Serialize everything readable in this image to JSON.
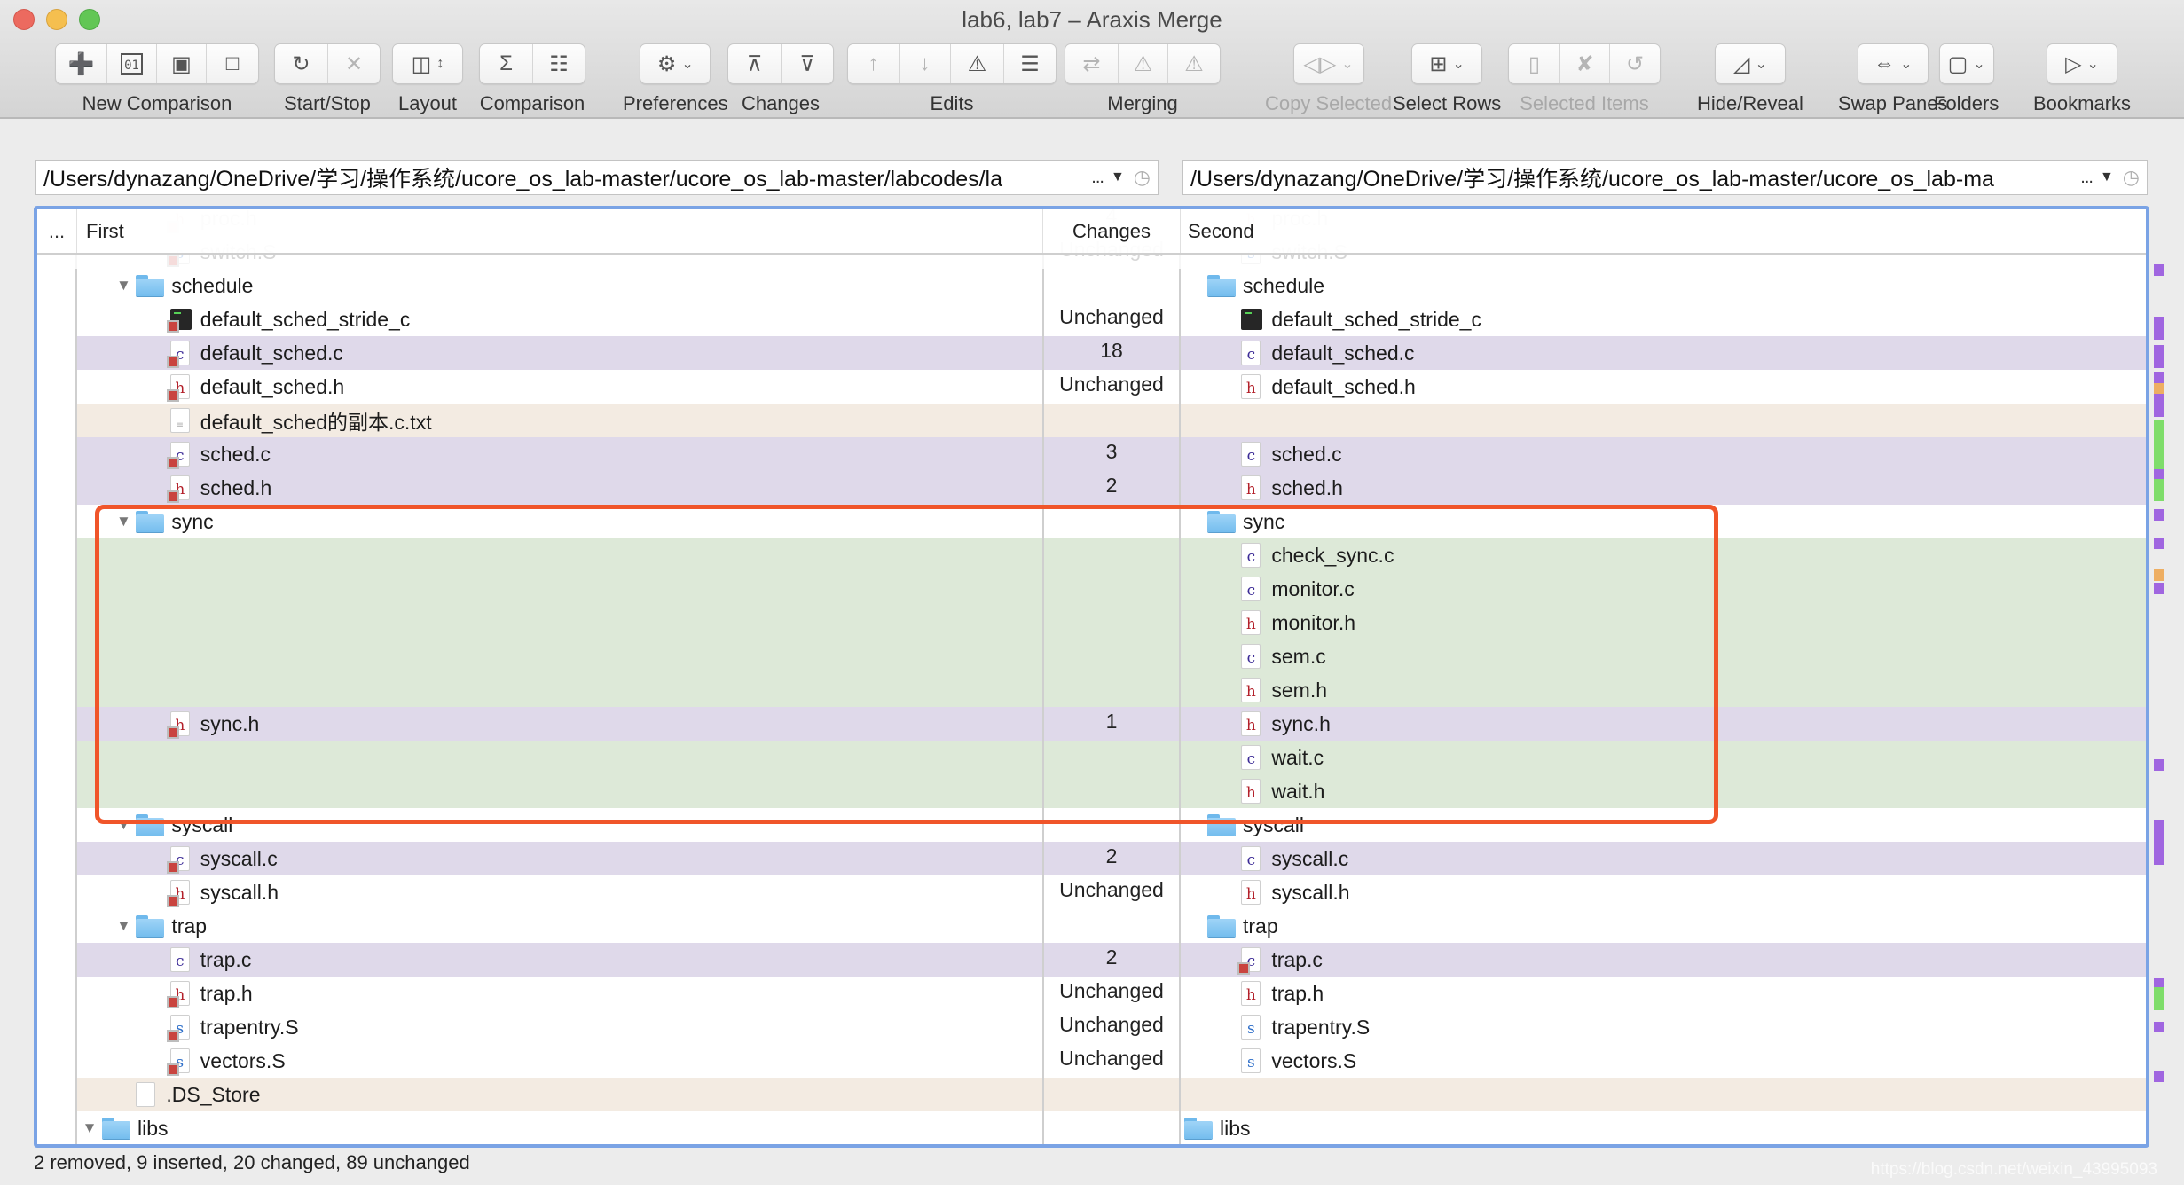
{
  "window": {
    "title": "lab6, lab7 – Araxis Merge"
  },
  "toolbar": {
    "groups": [
      {
        "label": "New Comparison",
        "enabled": true,
        "buttons": [
          {
            "icon": "new-text-comparison-icon",
            "glyph": "➕",
            "enabled": true
          },
          {
            "icon": "new-binary-comparison-icon",
            "glyph": "01",
            "enabled": true
          },
          {
            "icon": "new-image-comparison-icon",
            "glyph": "▣",
            "enabled": true
          },
          {
            "icon": "new-folder-comparison-icon",
            "glyph": "□",
            "enabled": true
          }
        ]
      },
      {
        "label": "Start/Stop",
        "enabled": true,
        "buttons": [
          {
            "icon": "refresh-icon",
            "glyph": "↻",
            "enabled": true
          },
          {
            "icon": "stop-icon",
            "glyph": "✕",
            "enabled": false
          }
        ]
      },
      {
        "label": "Layout",
        "enabled": true,
        "buttons": [
          {
            "icon": "two-pane-layout-icon",
            "glyph": "◫",
            "enabled": true,
            "dropdown": "↕"
          }
        ]
      },
      {
        "label": "Comparison",
        "enabled": true,
        "buttons": [
          {
            "icon": "sigma-report-icon",
            "glyph": "Σ",
            "enabled": true
          },
          {
            "icon": "document-report-icon",
            "glyph": "☷",
            "enabled": true
          }
        ]
      },
      {
        "label": "Preferences",
        "enabled": true,
        "buttons": [
          {
            "icon": "gear-icon",
            "glyph": "⚙",
            "enabled": true,
            "dropdown": "⌄"
          }
        ]
      },
      {
        "label": "Changes",
        "enabled": true,
        "buttons": [
          {
            "icon": "previous-change-icon",
            "glyph": "⊼",
            "enabled": true
          },
          {
            "icon": "next-change-icon",
            "glyph": "⊽",
            "enabled": true
          }
        ]
      },
      {
        "label": "Edits",
        "enabled": true,
        "buttons": [
          {
            "icon": "previous-edit-icon",
            "glyph": "↑",
            "enabled": false
          },
          {
            "icon": "next-edit-icon",
            "glyph": "↓",
            "enabled": false
          },
          {
            "icon": "conflict-edit-icon",
            "glyph": "⚠",
            "enabled": true
          },
          {
            "icon": "edit-list-icon",
            "glyph": "☰",
            "enabled": true
          }
        ]
      },
      {
        "label": "Merging",
        "enabled": true,
        "buttons": [
          {
            "icon": "merge-icon",
            "glyph": "⇄",
            "enabled": false
          },
          {
            "icon": "previous-conflict-icon",
            "glyph": "⚠",
            "enabled": false
          },
          {
            "icon": "next-conflict-icon",
            "glyph": "⚠",
            "enabled": false
          }
        ]
      },
      {
        "label": "Copy Selected",
        "enabled": false,
        "buttons": [
          {
            "icon": "copy-selected-icon",
            "glyph": "◁▷",
            "enabled": false,
            "dropdown": "⌄"
          }
        ]
      },
      {
        "label": "Select Rows",
        "enabled": true,
        "buttons": [
          {
            "icon": "select-rows-icon",
            "glyph": "⊞",
            "enabled": true,
            "dropdown": "⌄"
          }
        ]
      },
      {
        "label": "Selected Items",
        "enabled": false,
        "buttons": [
          {
            "icon": "open-items-icon",
            "glyph": "▯",
            "enabled": false
          },
          {
            "icon": "delete-items-icon",
            "glyph": "✘",
            "enabled": false
          },
          {
            "icon": "touch-items-icon",
            "glyph": "↺",
            "enabled": false
          }
        ]
      },
      {
        "label": "Hide/Reveal",
        "enabled": true,
        "buttons": [
          {
            "icon": "hide-reveal-icon",
            "glyph": "◿",
            "enabled": true,
            "dropdown": "⌄"
          }
        ]
      },
      {
        "label": "Swap Panes",
        "enabled": true,
        "buttons": [
          {
            "icon": "swap-panes-icon",
            "glyph": "⇔",
            "enabled": true,
            "dropdown": "⌄"
          }
        ]
      },
      {
        "label": "Folders",
        "enabled": true,
        "buttons": [
          {
            "icon": "folders-icon",
            "glyph": "▢",
            "enabled": true,
            "dropdown": "⌄"
          }
        ]
      },
      {
        "label": "Bookmarks",
        "enabled": true,
        "buttons": [
          {
            "icon": "bookmark-icon",
            "glyph": "▷",
            "enabled": true,
            "dropdown": "⌄"
          }
        ]
      }
    ]
  },
  "paths": {
    "first": "/Users/dynazang/OneDrive/学习/操作系统/ucore_os_lab-master/ucore_os_lab-master/labcodes/la",
    "second": "/Users/dynazang/OneDrive/学习/操作系统/ucore_os_lab-master/ucore_os_lab-ma",
    "ellipsis": "...",
    "dropdown_glyph": "▼",
    "history_glyph": "◷"
  },
  "table": {
    "headers": {
      "gutter": "...",
      "first": "First",
      "changes": "Changes",
      "second": "Second"
    },
    "rows": [
      {
        "status": "faded",
        "first": {
          "name": "proc.h",
          "type": "h",
          "indent": 2,
          "removed_badge": true
        },
        "changes": "4",
        "second": {
          "name": "proc.h",
          "type": "h",
          "indent": 1
        }
      },
      {
        "status": "faded",
        "first": {
          "name": "switch.S",
          "type": "s",
          "indent": 2,
          "removed_badge": true
        },
        "changes": "Unchanged",
        "second": {
          "name": "switch.S",
          "type": "s",
          "indent": 1
        }
      },
      {
        "status": "normal",
        "first": {
          "name": "schedule",
          "type": "folder",
          "indent": 1,
          "expanded": true
        },
        "changes": "",
        "second": {
          "name": "schedule",
          "type": "folder",
          "indent": 0
        }
      },
      {
        "status": "normal",
        "first": {
          "name": "default_sched_stride_c",
          "type": "exec",
          "indent": 2,
          "removed_badge": true
        },
        "changes": "Unchanged",
        "second": {
          "name": "default_sched_stride_c",
          "type": "exec",
          "indent": 1
        }
      },
      {
        "status": "changed",
        "first": {
          "name": "default_sched.c",
          "type": "c",
          "indent": 2,
          "removed_badge": true
        },
        "changes": "18",
        "second": {
          "name": "default_sched.c",
          "type": "c",
          "indent": 1
        }
      },
      {
        "status": "normal",
        "first": {
          "name": "default_sched.h",
          "type": "h",
          "indent": 2,
          "removed_badge": true
        },
        "changes": "Unchanged",
        "second": {
          "name": "default_sched.h",
          "type": "h",
          "indent": 1
        }
      },
      {
        "status": "removed",
        "first": {
          "name": "default_sched的副本.c.txt",
          "type": "txt",
          "indent": 2
        },
        "changes": "",
        "second": null
      },
      {
        "status": "changed",
        "first": {
          "name": "sched.c",
          "type": "c",
          "indent": 2,
          "removed_badge": true
        },
        "changes": "3",
        "second": {
          "name": "sched.c",
          "type": "c",
          "indent": 1
        }
      },
      {
        "status": "changed",
        "first": {
          "name": "sched.h",
          "type": "h",
          "indent": 2,
          "removed_badge": true
        },
        "changes": "2",
        "second": {
          "name": "sched.h",
          "type": "h",
          "indent": 1
        }
      },
      {
        "status": "normal",
        "first": {
          "name": "sync",
          "type": "folder",
          "indent": 1,
          "expanded": true
        },
        "changes": "",
        "second": {
          "name": "sync",
          "type": "folder",
          "indent": 0
        }
      },
      {
        "status": "inserted",
        "first": null,
        "changes": "",
        "second": {
          "name": "check_sync.c",
          "type": "c",
          "indent": 1
        }
      },
      {
        "status": "inserted",
        "first": null,
        "changes": "",
        "second": {
          "name": "monitor.c",
          "type": "c",
          "indent": 1
        }
      },
      {
        "status": "inserted",
        "first": null,
        "changes": "",
        "second": {
          "name": "monitor.h",
          "type": "h",
          "indent": 1
        }
      },
      {
        "status": "inserted",
        "first": null,
        "changes": "",
        "second": {
          "name": "sem.c",
          "type": "c",
          "indent": 1
        }
      },
      {
        "status": "inserted",
        "first": null,
        "changes": "",
        "second": {
          "name": "sem.h",
          "type": "h",
          "indent": 1
        }
      },
      {
        "status": "changed",
        "first": {
          "name": "sync.h",
          "type": "h",
          "indent": 2,
          "removed_badge": true
        },
        "changes": "1",
        "second": {
          "name": "sync.h",
          "type": "h",
          "indent": 1
        }
      },
      {
        "status": "inserted",
        "first": null,
        "changes": "",
        "second": {
          "name": "wait.c",
          "type": "c",
          "indent": 1
        }
      },
      {
        "status": "inserted",
        "first": null,
        "changes": "",
        "second": {
          "name": "wait.h",
          "type": "h",
          "indent": 1
        }
      },
      {
        "status": "normal",
        "first": {
          "name": "syscall",
          "type": "folder",
          "indent": 1,
          "expanded": true
        },
        "changes": "",
        "second": {
          "name": "syscall",
          "type": "folder",
          "indent": 0
        }
      },
      {
        "status": "changed",
        "first": {
          "name": "syscall.c",
          "type": "c",
          "indent": 2,
          "removed_badge": true
        },
        "changes": "2",
        "second": {
          "name": "syscall.c",
          "type": "c",
          "indent": 1
        }
      },
      {
        "status": "normal",
        "first": {
          "name": "syscall.h",
          "type": "h",
          "indent": 2,
          "removed_badge": true
        },
        "changes": "Unchanged",
        "second": {
          "name": "syscall.h",
          "type": "h",
          "indent": 1
        }
      },
      {
        "status": "normal",
        "first": {
          "name": "trap",
          "type": "folder",
          "indent": 1,
          "expanded": true
        },
        "changes": "",
        "second": {
          "name": "trap",
          "type": "folder",
          "indent": 0
        }
      },
      {
        "status": "changed",
        "first": {
          "name": "trap.c",
          "type": "c",
          "indent": 2
        },
        "changes": "2",
        "second": {
          "name": "trap.c",
          "type": "c",
          "indent": 1,
          "removed_badge": true
        }
      },
      {
        "status": "normal",
        "first": {
          "name": "trap.h",
          "type": "h",
          "indent": 2,
          "removed_badge": true
        },
        "changes": "Unchanged",
        "second": {
          "name": "trap.h",
          "type": "h",
          "indent": 1
        }
      },
      {
        "status": "normal",
        "first": {
          "name": "trapentry.S",
          "type": "s",
          "indent": 2,
          "removed_badge": true
        },
        "changes": "Unchanged",
        "second": {
          "name": "trapentry.S",
          "type": "s",
          "indent": 1
        }
      },
      {
        "status": "normal",
        "first": {
          "name": "vectors.S",
          "type": "s",
          "indent": 2,
          "removed_badge": true
        },
        "changes": "Unchanged",
        "second": {
          "name": "vectors.S",
          "type": "s",
          "indent": 1
        }
      },
      {
        "status": "removed",
        "first": {
          "name": ".DS_Store",
          "type": "blank",
          "indent": 1
        },
        "changes": "",
        "second": null
      },
      {
        "status": "normal",
        "first": {
          "name": "libs",
          "type": "folder",
          "indent": 0,
          "expanded": true
        },
        "changes": "",
        "second": {
          "name": "libs",
          "type": "folder",
          "indent": -1
        }
      }
    ]
  },
  "overview_markers": [
    {
      "pos": 0.062,
      "span": 0.012,
      "kind": "changed"
    },
    {
      "pos": 0.118,
      "span": 0.024,
      "kind": "changed"
    },
    {
      "pos": 0.148,
      "span": 0.024,
      "kind": "changed"
    },
    {
      "pos": 0.176,
      "span": 0.012,
      "kind": "changed"
    },
    {
      "pos": 0.188,
      "span": 0.012,
      "kind": "removed"
    },
    {
      "pos": 0.2,
      "span": 0.024,
      "kind": "changed"
    },
    {
      "pos": 0.228,
      "span": 0.058,
      "kind": "inserted"
    },
    {
      "pos": 0.28,
      "span": 0.01,
      "kind": "changed"
    },
    {
      "pos": 0.29,
      "span": 0.024,
      "kind": "inserted"
    },
    {
      "pos": 0.322,
      "span": 0.012,
      "kind": "changed"
    },
    {
      "pos": 0.352,
      "span": 0.012,
      "kind": "changed"
    },
    {
      "pos": 0.386,
      "span": 0.012,
      "kind": "removed"
    },
    {
      "pos": 0.4,
      "span": 0.012,
      "kind": "changed"
    },
    {
      "pos": 0.588,
      "span": 0.012,
      "kind": "changed"
    },
    {
      "pos": 0.652,
      "span": 0.048,
      "kind": "changed"
    },
    {
      "pos": 0.82,
      "span": 0.01,
      "kind": "changed"
    },
    {
      "pos": 0.83,
      "span": 0.024,
      "kind": "inserted"
    },
    {
      "pos": 0.866,
      "span": 0.012,
      "kind": "changed"
    },
    {
      "pos": 0.918,
      "span": 0.012,
      "kind": "changed"
    }
  ],
  "colors": {
    "changed": "#a066e0",
    "inserted": "#7edd6a",
    "removed": "#eeae62",
    "annotation": "#f0552a",
    "focus_border": "#7aa3e5"
  },
  "status_bar": {
    "summary": "2 removed, 9 inserted, 20 changed, 89 unchanged"
  },
  "watermark": "https://blog.csdn.net/weixin_43995093"
}
